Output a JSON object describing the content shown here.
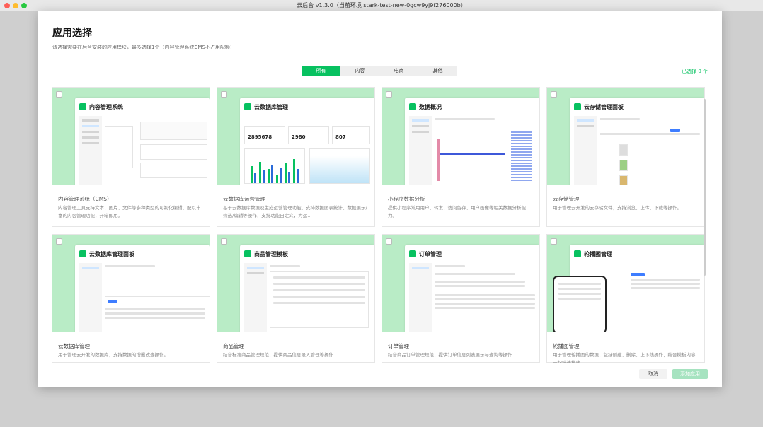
{
  "window": {
    "title": "云后台 v1.3.0（当前环境 stark-test-new-0gcw9yj9f276000b）"
  },
  "dialog": {
    "title": "应用选择",
    "subtitle": "请选择需要在后台安装的应用模块，最多选择1个（内容管理系统CMS不占用配额）",
    "selected_count": "已选择 0 个",
    "cancel_label": "取消",
    "add_label": "添加应用"
  },
  "tabs": [
    {
      "label": "所有",
      "active": true
    },
    {
      "label": "内容",
      "active": false
    },
    {
      "label": "电商",
      "active": false
    },
    {
      "label": "其他",
      "active": false
    }
  ],
  "cards": [
    {
      "name": "内容管理系统（CMS）",
      "desc": "内容管理工具支持文本、图片、文件等多种类型的可视化编辑，配以丰富的内容管理功能，开箱即用。",
      "preview_title": "内容管理系统"
    },
    {
      "name": "云数据库运营管理",
      "desc": "基于云数据库数据及生成运营管理功能，支持数据图表统计、数据展示/筛选/编辑等操作，支持功能自定义，为运...",
      "preview_title": "云数据库管理",
      "preview_stats": [
        "2895678",
        "2980",
        "807"
      ]
    },
    {
      "name": "小程序数据分析",
      "desc": "提供小程序常用用户、转发、访问留存、用户画像等相关数据分析能力。",
      "preview_title": "数据概况"
    },
    {
      "name": "云存储管理",
      "desc": "用于管理云开发的云存储文件，支持浏览、上传、下载等操作。",
      "preview_title": "云存储管理面板"
    },
    {
      "name": "云数据库管理",
      "desc": "用于管理云开发的数据库，支持数据的增删改查操作。",
      "preview_title": "云数据库管理面板"
    },
    {
      "name": "商品管理",
      "desc": "结合标准商品管理规范，提供商品信息录入管理等操作",
      "preview_title": "商品管理模板"
    },
    {
      "name": "订单管理",
      "desc": "结合商品订单管理规范，提供订单信息列表展示与查询等操作",
      "preview_title": "订单管理"
    },
    {
      "name": "轮播图管理",
      "desc": "用于管理轮播图的数据，包括创建、删除、上下线操作，结合模板内容一起快速搭建",
      "preview_title": "轮播图管理"
    }
  ],
  "colors": {
    "accent": "#07c160",
    "thumb_bg": "#b9ecc6"
  }
}
